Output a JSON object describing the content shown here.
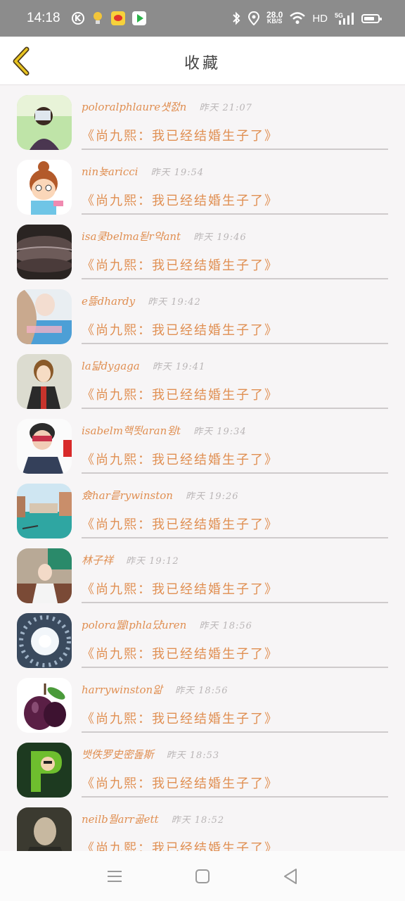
{
  "status_bar": {
    "time": "14:18",
    "speed_value": "28.0",
    "speed_unit": "KB/S",
    "network": "HD",
    "signal_label": "5G"
  },
  "header": {
    "title": "收藏",
    "back_icon": "back-chevron-icon",
    "accent": "#e8c420"
  },
  "colors": {
    "text_accent": "#e08f52",
    "time_text": "#b9b5b6"
  },
  "messages": [
    {
      "name": "poloralphlaure섓젌n",
      "time": "昨天 21:07",
      "text": "《尚九熙：我已经结婚生子了》"
    },
    {
      "name": "nin뇾aricci",
      "time": "昨天 19:54",
      "text": "《尚九熙：我已经结婚生子了》"
    },
    {
      "name": "isa쿶belma됟r약ant",
      "time": "昨天 19:46",
      "text": "《尚九熙：我已经结婚生子了》"
    },
    {
      "name": "e뜷dhardy",
      "time": "昨天 19:42",
      "text": "《尚九熙：我已经结婚生子了》"
    },
    {
      "name": "la댧dygaga",
      "time": "昨天 19:41",
      "text": "《尚九熙：我已经结婚生子了》"
    },
    {
      "name": "isabelm핵뙷aran윙t",
      "time": "昨天 19:34",
      "text": "《尚九熙：我已经结婚生子了》"
    },
    {
      "name": "僉har릍rywinston",
      "time": "昨天 19:26",
      "text": "《尚九熙：我已经结婚生子了》"
    },
    {
      "name": "林子祥",
      "time": "昨天 19:12",
      "text": "《尚九熙：我已经结婚生子了》"
    },
    {
      "name": "polora뛢lphla댰uren",
      "time": "昨天 18:56",
      "text": "《尚九熙：我已经结婚生子了》"
    },
    {
      "name": "harrywinston앎",
      "time": "昨天 18:56",
      "text": "《尚九熙：我已经结婚生子了》"
    },
    {
      "name": "뱃佚罗史密돒斯",
      "time": "昨天 18:53",
      "text": "《尚九熙：我已经结婚生子了》"
    },
    {
      "name": "neilb뭘arr곪ett",
      "time": "昨天 18:52",
      "text": "《尚九熙：我已经结婚生子了》"
    }
  ]
}
